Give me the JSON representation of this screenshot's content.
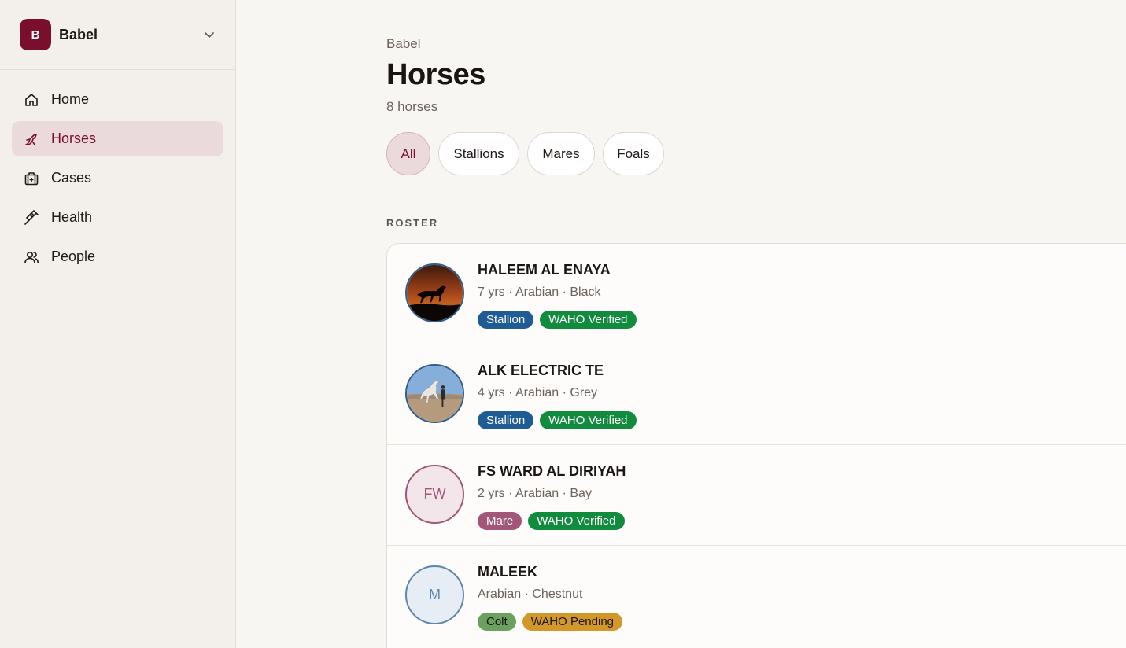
{
  "workspace": {
    "initial": "B",
    "name": "Babel"
  },
  "nav": [
    {
      "label": "Home",
      "icon": "home-icon",
      "active": false
    },
    {
      "label": "Horses",
      "icon": "horse-icon",
      "active": true
    },
    {
      "label": "Cases",
      "icon": "medical-case-icon",
      "active": false
    },
    {
      "label": "Health",
      "icon": "syringe-icon",
      "active": false
    },
    {
      "label": "People",
      "icon": "people-icon",
      "active": false
    }
  ],
  "page": {
    "breadcrumb": "Babel",
    "title": "Horses",
    "count": "8 horses",
    "section_label": "ROSTER"
  },
  "filters": [
    {
      "label": "All",
      "active": true
    },
    {
      "label": "Stallions",
      "active": false
    },
    {
      "label": "Mares",
      "active": false
    },
    {
      "label": "Foals",
      "active": false
    }
  ],
  "horses": [
    {
      "name": "HALEEM AL ENAYA",
      "meta": "7 yrs · Arabian · Black",
      "avatar": "photo-sunset-horse",
      "tags": [
        {
          "label": "Stallion",
          "bg": "#1f5c95",
          "fg": "#ffffff"
        },
        {
          "label": "WAHO Verified",
          "bg": "#118c3e",
          "fg": "#ffffff"
        }
      ]
    },
    {
      "name": "ALK ELECTRIC TE",
      "meta": "4 yrs · Arabian · Grey",
      "avatar": "photo-grey-horse",
      "tags": [
        {
          "label": "Stallion",
          "bg": "#1f5c95",
          "fg": "#ffffff"
        },
        {
          "label": "WAHO Verified",
          "bg": "#118c3e",
          "fg": "#ffffff"
        }
      ]
    },
    {
      "name": "FS WARD AL DIRIYAH",
      "meta": "2 yrs · Arabian · Bay",
      "avatar": "initials",
      "initials": "FW",
      "tags": [
        {
          "label": "Mare",
          "bg": "#a2567a",
          "fg": "#ffffff"
        },
        {
          "label": "WAHO Verified",
          "bg": "#118c3e",
          "fg": "#ffffff"
        }
      ]
    },
    {
      "name": "MALEEK",
      "meta": "Arabian · Chestnut",
      "avatar": "initials",
      "initials": "M",
      "tags": [
        {
          "label": "Colt",
          "bg": "#6aa15f",
          "fg": "#1a1512"
        },
        {
          "label": "WAHO Pending",
          "bg": "#d3982a",
          "fg": "#1a1512"
        }
      ]
    }
  ],
  "colors": {
    "brand": "#7a0f2c",
    "active_bg": "#ebdadb"
  }
}
